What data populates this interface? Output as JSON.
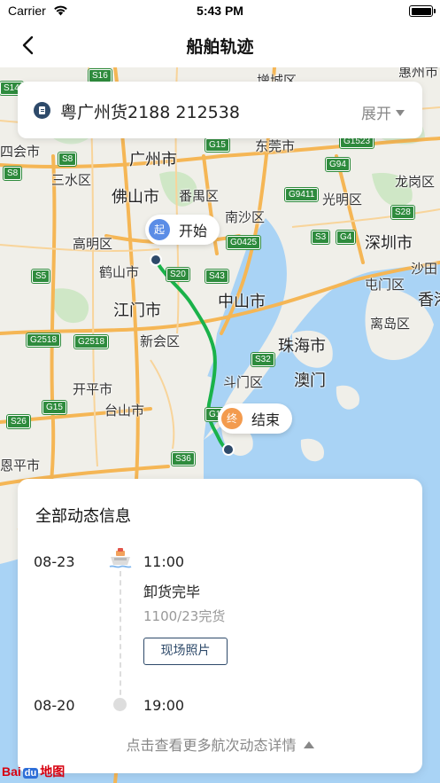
{
  "status_bar": {
    "carrier": "Carrier",
    "time": "5:43 PM"
  },
  "nav": {
    "title": "船舶轨迹",
    "back_icon": "chevron-left-icon"
  },
  "ship_card": {
    "name": "粤广州货2188 212538",
    "expand_label": "展开"
  },
  "map": {
    "cities": [
      {
        "name": "广州市",
        "big": true
      },
      {
        "name": "佛山市",
        "big": true
      },
      {
        "name": "东莞市",
        "big": false
      },
      {
        "name": "江门市",
        "big": true
      },
      {
        "name": "中山市",
        "big": true
      },
      {
        "name": "珠海市",
        "big": true
      },
      {
        "name": "澳门",
        "big": true
      },
      {
        "name": "深圳市",
        "big": true
      },
      {
        "name": "香港",
        "big": true
      },
      {
        "name": "惠州市",
        "big": false
      },
      {
        "name": "三水区",
        "big": false
      },
      {
        "name": "四会市",
        "big": false
      },
      {
        "name": "高明区",
        "big": false
      },
      {
        "name": "鹤山市",
        "big": false
      },
      {
        "name": "新会区",
        "big": false
      },
      {
        "name": "开平市",
        "big": false
      },
      {
        "name": "台山市",
        "big": false
      },
      {
        "name": "恩平市",
        "big": false
      },
      {
        "name": "番禺区",
        "big": false
      },
      {
        "name": "南沙区",
        "big": false
      },
      {
        "name": "斗门区",
        "big": false
      },
      {
        "name": "光明区",
        "big": false
      },
      {
        "name": "龙岗区",
        "big": false
      },
      {
        "name": "屯门区",
        "big": false
      },
      {
        "name": "离岛区",
        "big": false
      },
      {
        "name": "沙田",
        "big": false
      },
      {
        "name": "增城区",
        "big": false
      }
    ],
    "roads": [
      "S16",
      "S14",
      "S8",
      "S8",
      "G94",
      "G9411",
      "G1523",
      "G15",
      "S28",
      "S3",
      "G4",
      "S20",
      "S43",
      "G0425",
      "S5",
      "G2518",
      "G2518",
      "S32",
      "S26",
      "G15",
      "S36",
      "G1"
    ],
    "pin_start": {
      "badge": "起",
      "label": "开始"
    },
    "pin_end": {
      "badge": "终",
      "label": "结束"
    }
  },
  "panel": {
    "title": "全部动态信息",
    "events": [
      {
        "date": "08-23",
        "time": "11:00",
        "status": "卸货完毕",
        "detail": "1100/23完货",
        "button": "现场照片"
      },
      {
        "date": "08-20",
        "time": "19:00"
      }
    ],
    "more_label": "点击查看更多航次动态详情"
  },
  "baidu_logo": {
    "left": "Bai",
    "mid": "du",
    "right": "地图"
  },
  "colors": {
    "route": "#1ab24a",
    "start": "#5b8de6",
    "end": "#f39b4e",
    "primary": "#2e4a6a"
  }
}
